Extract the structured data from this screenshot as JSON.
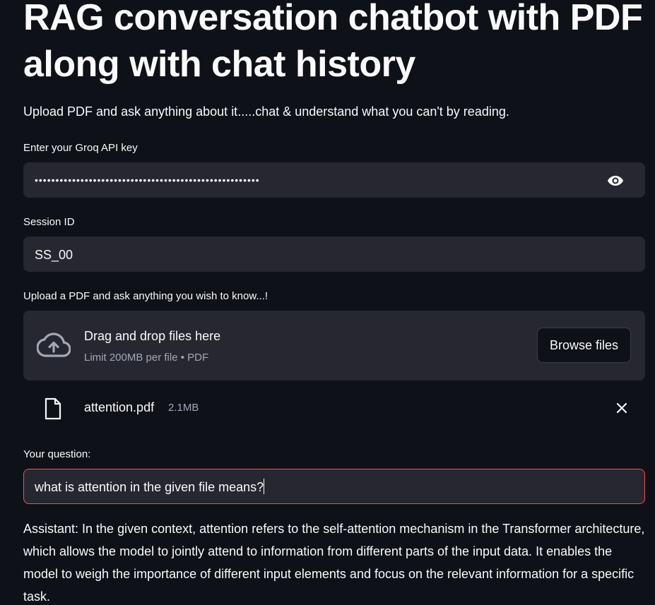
{
  "header": {
    "title": "RAG conversation chatbot with PDF along with chat history",
    "subtitle": "Upload PDF and ask anything about it.....chat & understand what you can't by reading."
  },
  "api_key": {
    "label": "Enter your Groq API key",
    "value": "••••••••••••••••••••••••••••••••••••••••••••••••••••••",
    "toggle_icon": "eye-icon"
  },
  "session": {
    "label": "Session ID",
    "value": "SS_00"
  },
  "uploader": {
    "label": "Upload a PDF and ask anything you wish to know...!",
    "dropzone_title": "Drag and drop files here",
    "dropzone_subtitle": "Limit 200MB per file • PDF",
    "browse_label": "Browse files",
    "icon": "cloud-upload-icon"
  },
  "uploaded_file": {
    "name": "attention.pdf",
    "size": "2.1MB",
    "icon": "file-icon",
    "remove_icon": "close-icon"
  },
  "question": {
    "label": "Your question:",
    "value": "what is attention in the given file means?"
  },
  "answer": {
    "text": "Assistant: In the given context, attention refers to the self-attention mechanism in the Transformer architecture, which allows the model to jointly attend to information from different parts of the input data. It enables the model to weigh the importance of different input elements and focus on the relevant information for a specific task."
  },
  "colors": {
    "background": "#0e1117",
    "field": "#262730",
    "focus_border": "#ff4b4b",
    "muted_text": "#a3a8b8"
  }
}
